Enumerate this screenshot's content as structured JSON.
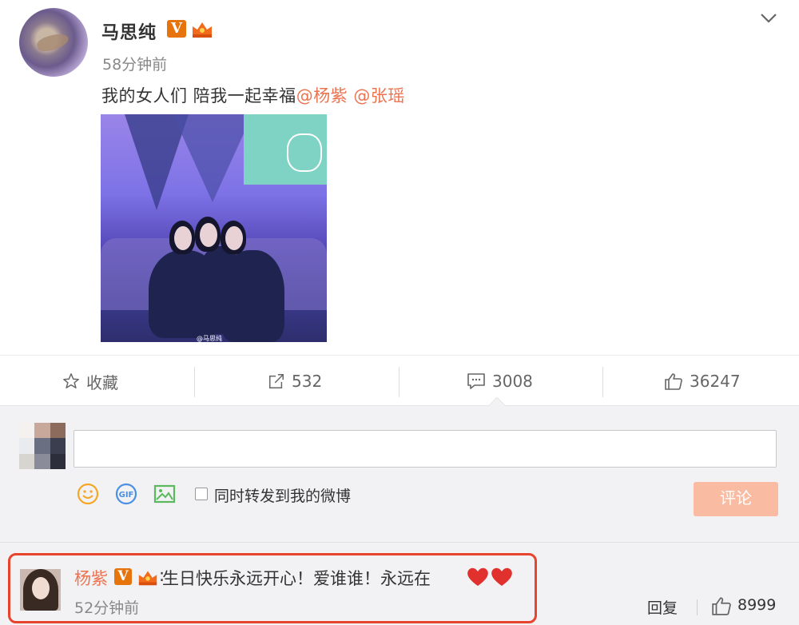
{
  "post": {
    "author": "马思纯",
    "time": "58分钟前",
    "text_prefix": "我的女人们 陪我一起幸福",
    "mentions": [
      "@杨紫",
      "@张瑶"
    ],
    "image_watermark": "@马思纯"
  },
  "actions": {
    "favorite": "收藏",
    "forward": "532",
    "comment": "3008",
    "like": "36247"
  },
  "composer": {
    "input_value": "",
    "forward_checkbox_label": "同时转发到我的微博",
    "forward_checked": false,
    "submit_label": "评论"
  },
  "comment": {
    "author": "杨紫",
    "text": "生日快乐永远开心！爱谁谁！永远在",
    "time": "52分钟前",
    "reply_label": "回复",
    "likes": "8999"
  },
  "colors": {
    "mention": "#eb7350",
    "verified_badge": "#e6730b",
    "submit_button": "#f9bba2",
    "highlight_border": "#e8432c",
    "heart": "#e0312e"
  }
}
